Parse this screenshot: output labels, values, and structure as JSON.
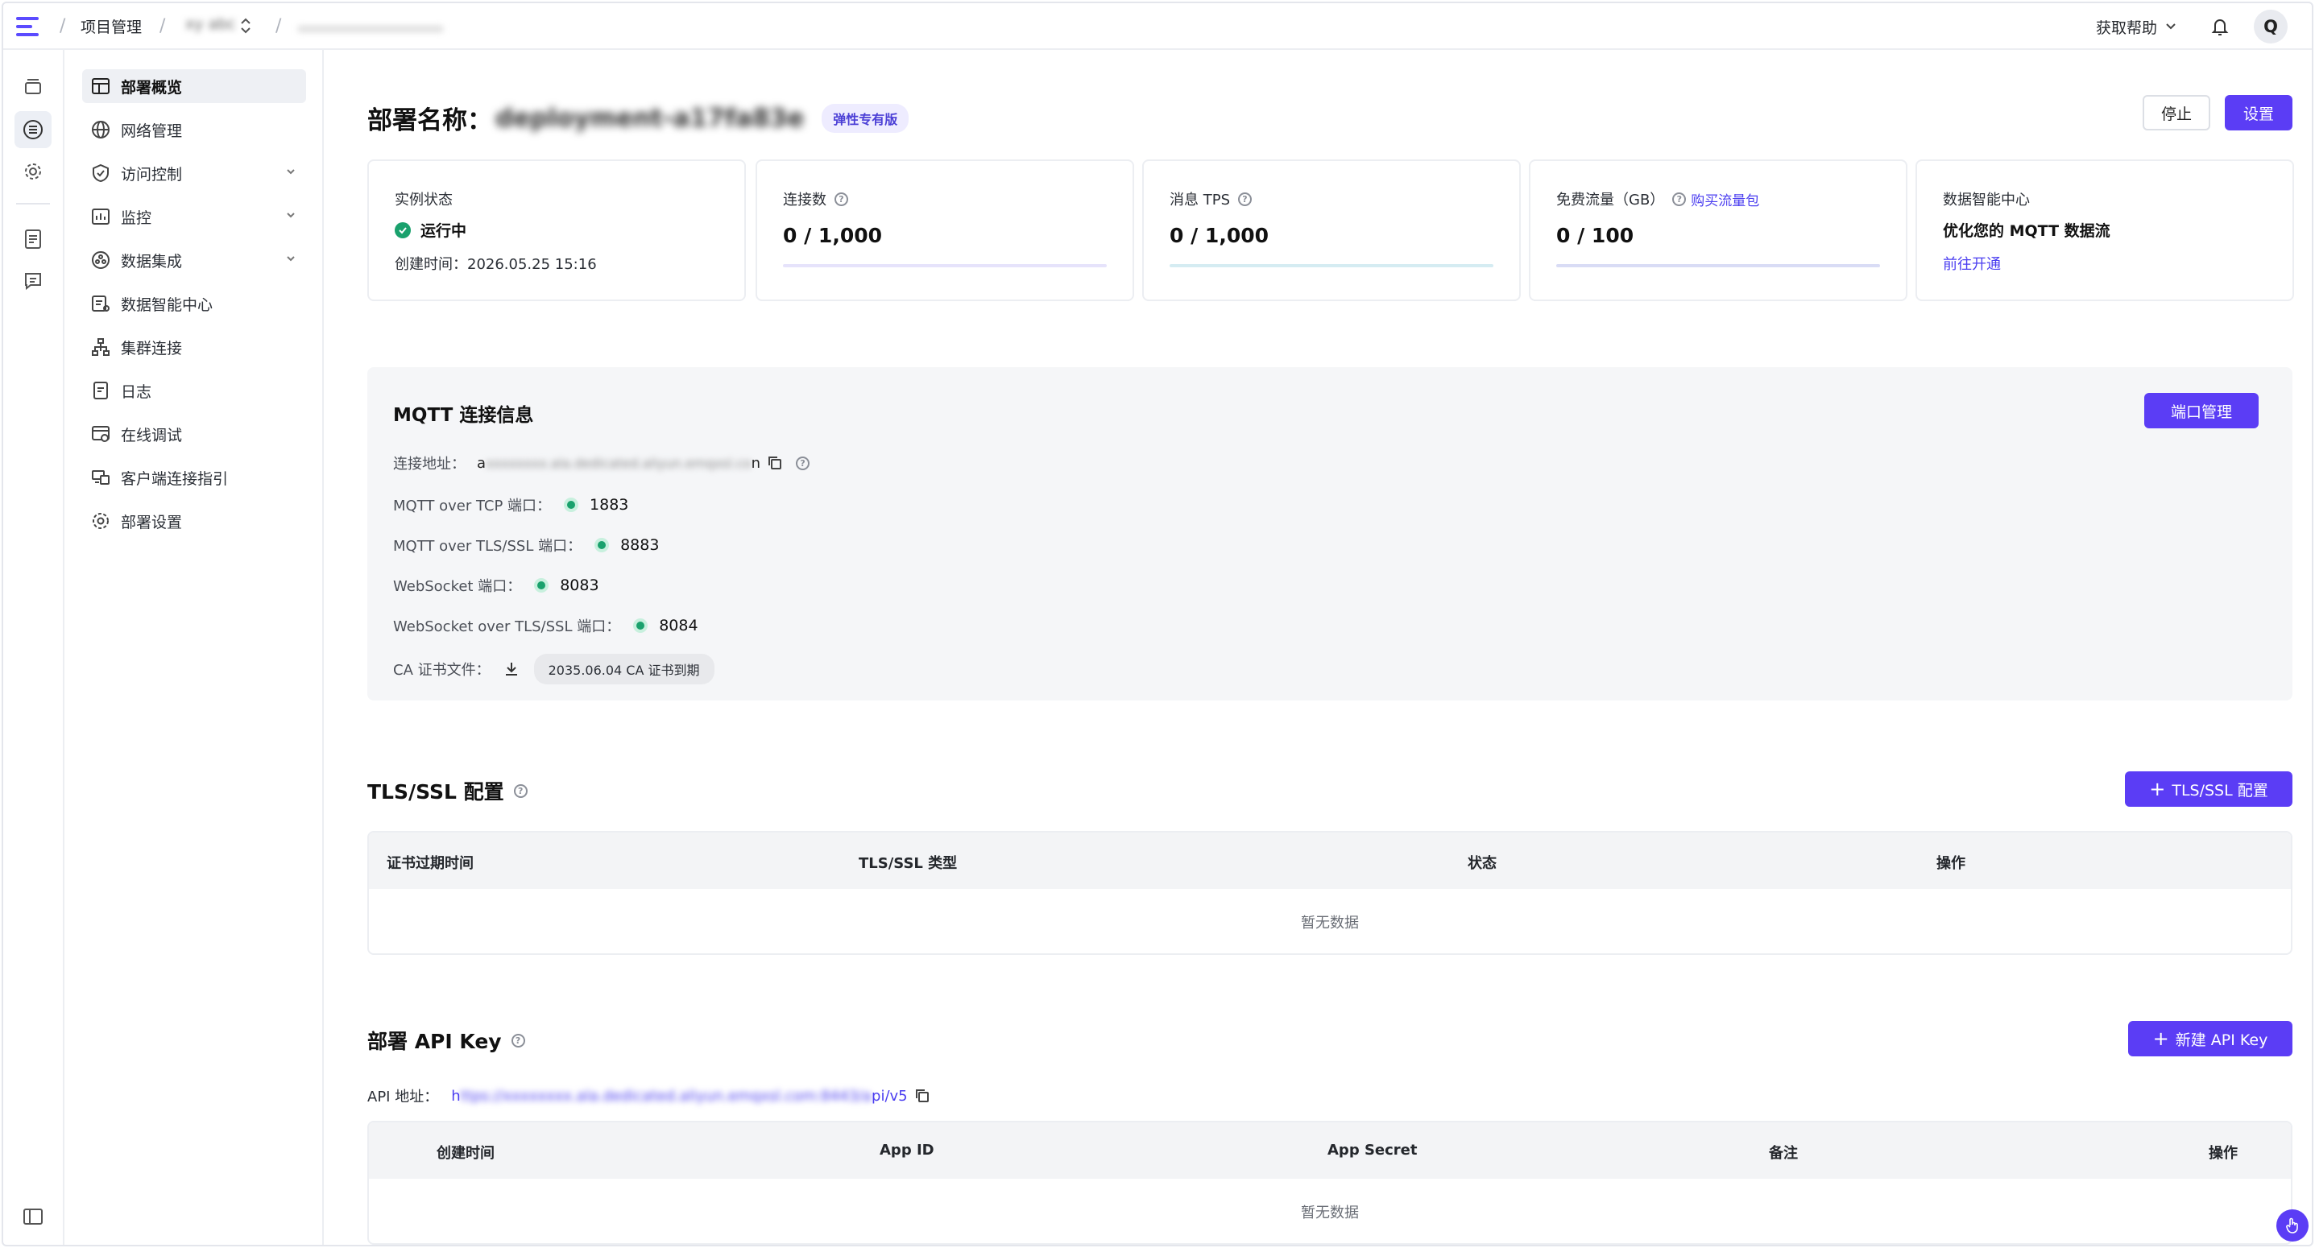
{
  "topbar": {
    "project": "项目管理",
    "org": "xy abc",
    "deployment": "c                         ",
    "help": "获取帮助",
    "avatar": "Q"
  },
  "sidebar": {
    "items": [
      {
        "label": "部署概览",
        "icon": "dashboard-icon",
        "active": true
      },
      {
        "label": "网络管理",
        "icon": "globe-icon"
      },
      {
        "label": "访问控制",
        "icon": "shield-icon",
        "expandable": true
      },
      {
        "label": "监控",
        "icon": "chart-icon",
        "expandable": true
      },
      {
        "label": "数据集成",
        "icon": "integration-icon",
        "expandable": true
      },
      {
        "label": "数据智能中心",
        "icon": "data-icon"
      },
      {
        "label": "集群连接",
        "icon": "cluster-icon"
      },
      {
        "label": "日志",
        "icon": "log-icon"
      },
      {
        "label": "在线调试",
        "icon": "debug-icon"
      },
      {
        "label": "客户端连接指引",
        "icon": "client-icon"
      },
      {
        "label": "部署设置",
        "icon": "gear-icon"
      }
    ]
  },
  "header": {
    "title_label": "部署名称：",
    "deployment_name": "deployment-a17fa83e",
    "tag": "弹性专有版",
    "stop": "停止",
    "settings": "设置"
  },
  "cards": {
    "status_label": "实例状态",
    "status_value": "运行中",
    "created": "创建时间：2026.05.25 15:16",
    "connections_label": "连接数",
    "connections_value": "0 / 1,000",
    "tps_label": "消息 TPS",
    "tps_value": "0 / 1,000",
    "traffic_label": "免费流量（GB）",
    "traffic_link": "购买流量包",
    "traffic_value": "0 / 100",
    "dic_label": "数据智能中心",
    "dic_value": "优化您的 MQTT 数据流",
    "dic_link": "前往开通"
  },
  "mqtt": {
    "title": "MQTT 连接信息",
    "port_mgmt": "端口管理",
    "address_label": "连接地址：",
    "address_start": "a",
    "address_masked": "xxxxxxxx.ala.dedicated.aliyun.emqxsl.co",
    "address_end": "n",
    "tcp_label": "MQTT over TCP 端口：",
    "tcp_port": "1883",
    "tls_label": "MQTT over TLS/SSL 端口：",
    "tls_port": "8883",
    "ws_label": "WebSocket 端口：",
    "ws_port": "8083",
    "wss_label": "WebSocket over TLS/SSL 端口：",
    "wss_port": "8084",
    "ca_label": "CA 证书文件：",
    "ca_expiry": "2035.06.04 CA 证书到期"
  },
  "tls": {
    "title": "TLS/SSL 配置",
    "add": "TLS/SSL 配置",
    "columns": [
      "证书过期时间",
      "TLS/SSL 类型",
      "状态",
      "操作"
    ],
    "empty": "暂无数据"
  },
  "api": {
    "title": "部署 API Key",
    "add": "新建 API Key",
    "address_label": "API 地址：",
    "url_start": "h",
    "url_masked": "ttps://xxxxxxxx.ala.dedicated.aliyun.emqxsl.com:8443/a",
    "url_end": "pi/v5",
    "columns": [
      "创建时间",
      "App ID",
      "App Secret",
      "备注",
      "操作"
    ],
    "empty": "暂无数据"
  },
  "colors": {
    "primary": "#5b3df5",
    "success": "#1aa16d"
  }
}
